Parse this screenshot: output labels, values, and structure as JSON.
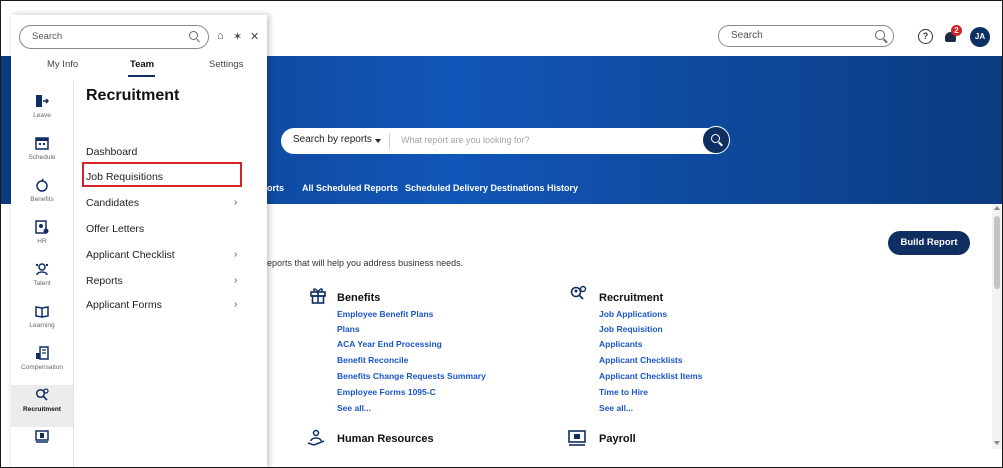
{
  "header": {
    "search_placeholder": "Search",
    "help_label": "?",
    "notification_count": "2",
    "avatar_initials": "JA"
  },
  "hero": {
    "search_type": "Search by reports",
    "search_placeholder": "What report are you looking for?",
    "tabs": [
      "orts",
      "All Scheduled Reports",
      "Scheduled Delivery Destinations History"
    ]
  },
  "content": {
    "build_report": "Build Report",
    "intro": "eports that will help you address business needs.",
    "benefits": {
      "title": "Benefits",
      "links": [
        "Employee Benefit Plans",
        "Plans",
        "ACA Year End Processing",
        "Benefit Reconcile",
        "Benefits Change Requests Summary",
        "Employee Forms 1095-C",
        "See all..."
      ]
    },
    "recruitment": {
      "title": "Recruitment",
      "links": [
        "Job Applications",
        "Job Requisition",
        "Applicants",
        "Applicant Checklists",
        "Applicant Checklist Items",
        "Time to Hire",
        "See all..."
      ]
    },
    "human_resources": {
      "title": "Human Resources"
    },
    "payroll": {
      "title": "Payroll"
    }
  },
  "panel": {
    "search_placeholder": "Search",
    "tabs": [
      "My Info",
      "Team",
      "Settings"
    ],
    "active_tab": "Team",
    "rail": [
      "Leave",
      "Schedule",
      "Benefits",
      "HR",
      "Talent",
      "Learning",
      "Compensation",
      "Recruitment"
    ],
    "active_rail": "Recruitment",
    "flyout_title": "Recruitment",
    "flyout_items": [
      "Dashboard",
      "Job Requisitions",
      "Candidates",
      "Offer Letters",
      "Applicant Checklist",
      "Reports",
      "Applicant Forms"
    ],
    "chevron": "›"
  },
  "colors": {
    "navy": "#0f2f63",
    "hero_blue": "#1156b8",
    "link_blue": "#1a56c4",
    "highlight_red": "#d8222a",
    "badge_red": "#d32027"
  }
}
